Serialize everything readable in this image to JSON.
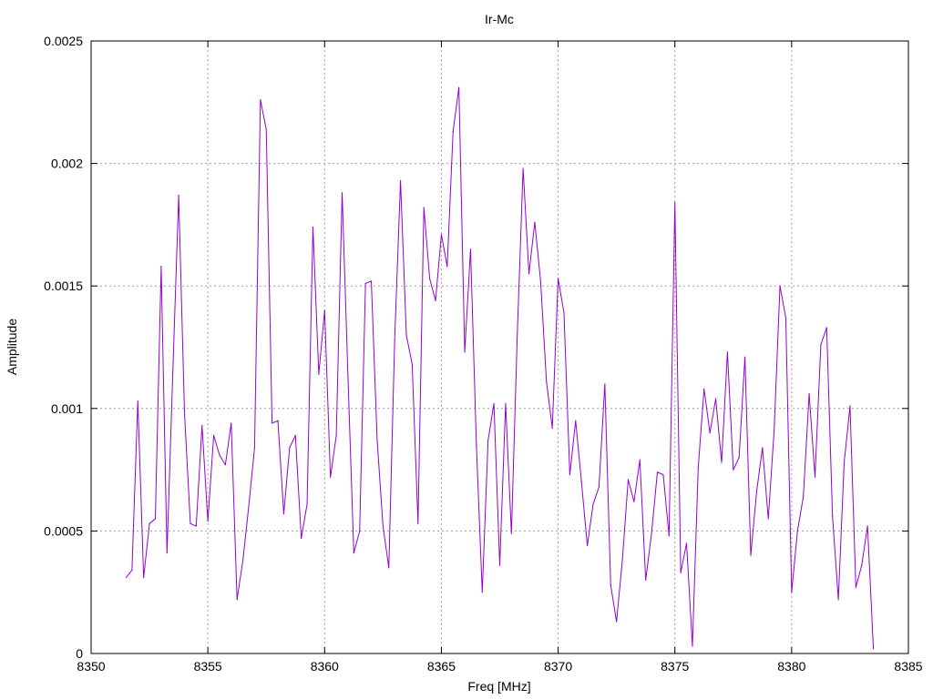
{
  "chart_data": {
    "type": "line",
    "title": "Ir-Mc",
    "xlabel": "Freq [MHz]",
    "ylabel": "Amplitude",
    "xlim": [
      8350,
      8385
    ],
    "ylim": [
      0,
      0.0025
    ],
    "x_ticks": [
      8350,
      8355,
      8360,
      8365,
      8370,
      8375,
      8380,
      8385
    ],
    "x_tick_labels": [
      "8350",
      "8355",
      "8360",
      "8365",
      "8370",
      "8375",
      "8380",
      "8385"
    ],
    "y_ticks": [
      0,
      0.0005,
      0.001,
      0.0015,
      0.002,
      0.0025
    ],
    "y_tick_labels": [
      "0",
      "0.0005",
      "0.001",
      "0.0015",
      "0.002",
      "0.0025"
    ],
    "grid": true,
    "line_color": "#9400d3",
    "series": [
      {
        "x": [
          8351.5,
          8351.75,
          8352.0,
          8352.25,
          8352.5,
          8352.75,
          8353.0,
          8353.25,
          8353.5,
          8353.75,
          8354.0,
          8354.25,
          8354.5,
          8354.75,
          8355.0,
          8355.25,
          8355.5,
          8355.75,
          8356.0,
          8356.25,
          8356.5,
          8356.75,
          8357.0,
          8357.25,
          8357.5,
          8357.75,
          8358.0,
          8358.25,
          8358.5,
          8358.75,
          8359.0,
          8359.25,
          8359.5,
          8359.75,
          8360.0,
          8360.25,
          8360.5,
          8360.75,
          8361.0,
          8361.25,
          8361.5,
          8361.75,
          8362.0,
          8362.25,
          8362.5,
          8362.75,
          8363.0,
          8363.25,
          8363.5,
          8363.75,
          8364.0,
          8364.25,
          8364.5,
          8364.75,
          8365.0,
          8365.25,
          8365.5,
          8365.75,
          8366.0,
          8366.25,
          8366.5,
          8366.75,
          8367.0,
          8367.25,
          8367.5,
          8367.75,
          8368.0,
          8368.25,
          8368.5,
          8368.75,
          8369.0,
          8369.25,
          8369.5,
          8369.75,
          8370.0,
          8370.25,
          8370.5,
          8370.75,
          8371.0,
          8371.25,
          8371.5,
          8371.75,
          8372.0,
          8372.25,
          8372.5,
          8372.75,
          8373.0,
          8373.25,
          8373.5,
          8373.75,
          8374.0,
          8374.25,
          8374.5,
          8374.75,
          8375.0,
          8375.25,
          8375.5,
          8375.75,
          8376.0,
          8376.25,
          8376.5,
          8376.75,
          8377.0,
          8377.25,
          8377.5,
          8377.75,
          8378.0,
          8378.25,
          8378.5,
          8378.75,
          8379.0,
          8379.25,
          8379.5,
          8379.75,
          8380.0,
          8380.25,
          8380.5,
          8380.75,
          8381.0,
          8381.25,
          8381.5,
          8381.75,
          8382.0,
          8382.25,
          8382.5,
          8382.75,
          8383.0,
          8383.25,
          8383.5
        ],
        "values": [
          0.00031,
          0.00034,
          0.00103,
          0.00031,
          0.00053,
          0.00055,
          0.00158,
          0.00041,
          0.00115,
          0.00187,
          0.00098,
          0.00053,
          0.00052,
          0.00093,
          0.00054,
          0.00089,
          0.00081,
          0.00077,
          0.00094,
          0.00022,
          0.00038,
          0.0006,
          0.00084,
          0.00226,
          0.00214,
          0.00094,
          0.00095,
          0.00057,
          0.00084,
          0.00089,
          0.00047,
          0.00061,
          0.00174,
          0.00114,
          0.0014,
          0.00072,
          0.00089,
          0.00188,
          0.00113,
          0.00041,
          0.0005,
          0.00151,
          0.00152,
          0.00087,
          0.00052,
          0.00035,
          0.00128,
          0.00193,
          0.0013,
          0.00118,
          0.00053,
          0.00182,
          0.00153,
          0.00144,
          0.00171,
          0.00158,
          0.00213,
          0.00231,
          0.00123,
          0.00165,
          0.00085,
          0.00025,
          0.00087,
          0.00102,
          0.00036,
          0.00102,
          0.00049,
          0.0013,
          0.00198,
          0.00155,
          0.00176,
          0.00152,
          0.00111,
          0.00092,
          0.00153,
          0.00139,
          0.00073,
          0.00095,
          0.0007,
          0.00044,
          0.00061,
          0.00068,
          0.0011,
          0.00028,
          0.00013,
          0.00038,
          0.00071,
          0.00062,
          0.00079,
          0.0003,
          0.00049,
          0.00074,
          0.00073,
          0.00048,
          0.00184,
          0.00033,
          0.00045,
          3e-05,
          0.00076,
          0.00108,
          0.0009,
          0.00104,
          0.00078,
          0.00123,
          0.00075,
          0.0008,
          0.00121,
          0.0004,
          0.00066,
          0.00084,
          0.00055,
          0.00091,
          0.0015,
          0.00137,
          0.00025,
          0.0005,
          0.00064,
          0.00106,
          0.00072,
          0.00126,
          0.00133,
          0.00056,
          0.00022,
          0.00078,
          0.00101,
          0.00027,
          0.00036,
          0.00052,
          2e-05
        ]
      }
    ]
  }
}
